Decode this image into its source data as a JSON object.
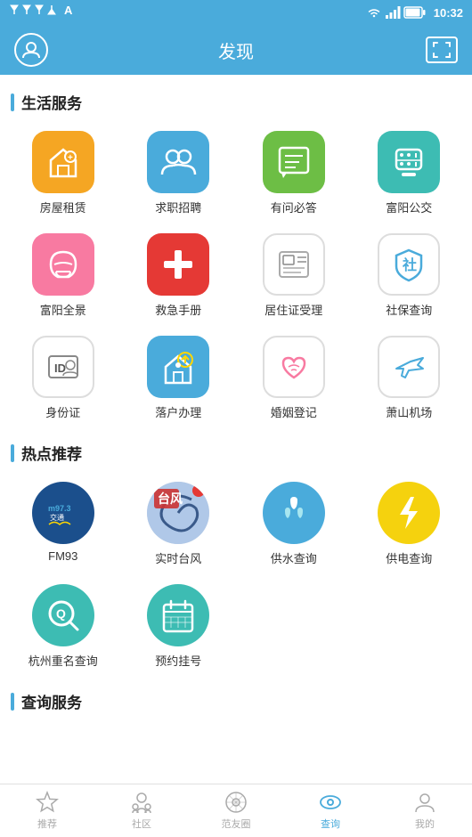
{
  "statusBar": {
    "time": "10:32",
    "icons": [
      "signal",
      "wifi",
      "battery"
    ]
  },
  "header": {
    "title": "发现",
    "leftIcon": "user-icon",
    "rightIcon": "scan-icon"
  },
  "sections": [
    {
      "id": "life-services",
      "title": "生活服务",
      "items": [
        {
          "id": "house-rent",
          "label": "房屋租赁",
          "icon": "house-rent-icon",
          "bg": "orange"
        },
        {
          "id": "job-recruit",
          "label": "求职招聘",
          "icon": "recruit-icon",
          "bg": "blue"
        },
        {
          "id": "qa",
          "label": "有问必答",
          "icon": "qa-icon",
          "bg": "green"
        },
        {
          "id": "fuyang-bus",
          "label": "富阳公交",
          "icon": "bus-icon",
          "bg": "teal"
        },
        {
          "id": "fuyang-panorama",
          "label": "富阳全景",
          "icon": "panorama-icon",
          "bg": "pink"
        },
        {
          "id": "emergency",
          "label": "救急手册",
          "icon": "emergency-icon",
          "bg": "red"
        },
        {
          "id": "residence-permit",
          "label": "居住证受理",
          "icon": "residence-icon",
          "bg": "white-border"
        },
        {
          "id": "social-security",
          "label": "社保查询",
          "icon": "social-icon",
          "bg": "shield"
        },
        {
          "id": "id-card",
          "label": "身份证",
          "icon": "id-icon",
          "bg": "white-border"
        },
        {
          "id": "settle-down",
          "label": "落户办理",
          "icon": "settle-icon",
          "bg": "blue"
        },
        {
          "id": "marriage",
          "label": "婚姻登记",
          "icon": "marriage-icon",
          "bg": "white-border"
        },
        {
          "id": "airport",
          "label": "萧山机场",
          "icon": "airport-icon",
          "bg": "white-border"
        }
      ]
    },
    {
      "id": "hot-recommend",
      "title": "热点推荐",
      "items": [
        {
          "id": "fm93",
          "label": "FM93",
          "icon": "fm93-icon",
          "bg": "dark-blue",
          "circle": true
        },
        {
          "id": "typhoon",
          "label": "实时台风",
          "icon": "typhoon-icon",
          "bg": "red-circle",
          "circle": true
        },
        {
          "id": "water",
          "label": "供水查询",
          "icon": "water-icon",
          "bg": "light-blue",
          "circle": true
        },
        {
          "id": "power",
          "label": "供电查询",
          "icon": "power-icon",
          "bg": "yellow",
          "circle": true
        },
        {
          "id": "hangzhou-name",
          "label": "杭州重名查询",
          "icon": "search-circle-icon",
          "bg": "teal-circle",
          "circle": true
        },
        {
          "id": "appointment",
          "label": "预约挂号",
          "icon": "calendar-icon",
          "bg": "blue-calendar",
          "circle": true
        }
      ]
    },
    {
      "id": "query-services",
      "title": "查询服务",
      "items": []
    }
  ],
  "bottomNav": [
    {
      "id": "recommend",
      "label": "推荐",
      "icon": "star-icon",
      "active": false
    },
    {
      "id": "community",
      "label": "社区",
      "icon": "community-icon",
      "active": false
    },
    {
      "id": "fan-circle",
      "label": "范友圈",
      "icon": "circle-icon",
      "active": false
    },
    {
      "id": "query",
      "label": "查询",
      "icon": "query-icon",
      "active": true
    },
    {
      "id": "mine",
      "label": "我的",
      "icon": "person-icon",
      "active": false
    }
  ]
}
